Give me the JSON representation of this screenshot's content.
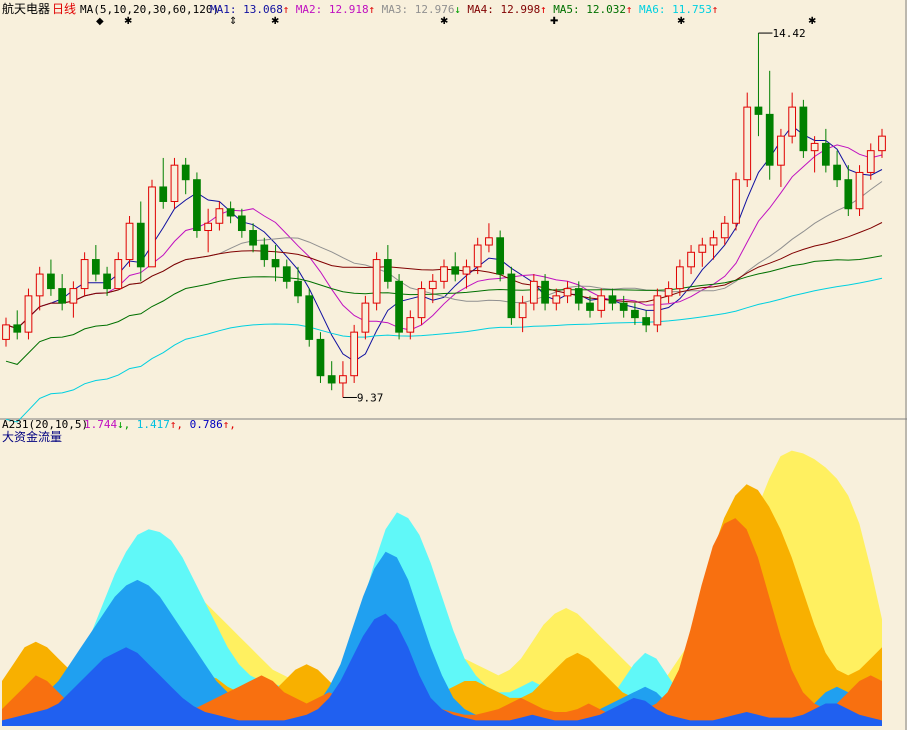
{
  "header": {
    "stock_name": "航天电器",
    "period": "日线",
    "ma_params": "MA(5,10,20,30,60,120)",
    "items": [
      {
        "label": "MA1:",
        "value": "13.068",
        "arrow": "↑",
        "color": "#1010A0"
      },
      {
        "label": "MA2:",
        "value": "12.918",
        "arrow": "↑",
        "color": "#C010C0"
      },
      {
        "label": "MA3:",
        "value": "12.976",
        "arrow": "↓",
        "color": "#909090"
      },
      {
        "label": "MA4:",
        "value": "12.998",
        "arrow": "↑",
        "color": "#800000"
      },
      {
        "label": "MA5:",
        "value": "12.032",
        "arrow": "↑",
        "color": "#007000"
      },
      {
        "label": "MA6:",
        "value": "11.753",
        "arrow": "↑",
        "color": "#00D0E0"
      }
    ],
    "arrow_up_color": "#E00000",
    "arrow_down_color": "#00A000"
  },
  "sub_header": {
    "indicator": "A231(20,10,5)",
    "values": [
      {
        "value": "1.744",
        "arrow": "↓",
        "color": "#C010C0"
      },
      {
        "value": "1.417",
        "arrow": "↑",
        "color": "#00C0E0"
      },
      {
        "value": "0.786",
        "arrow": "↑",
        "color": "#0000C0"
      }
    ],
    "title": "大资金流量"
  },
  "markers": {
    "high_label": "14.42",
    "low_label": "9.37"
  },
  "chart_data": [
    {
      "type": "candlestick",
      "title": "航天电器 日线",
      "ylim": [
        9.2,
        14.6
      ],
      "up_color": "#E00000",
      "down_color": "#008000",
      "candles": [
        [
          10.2,
          10.5,
          10.1,
          10.4
        ],
        [
          10.4,
          10.6,
          10.2,
          10.3
        ],
        [
          10.3,
          10.9,
          10.2,
          10.8
        ],
        [
          10.8,
          11.2,
          10.6,
          11.1
        ],
        [
          11.1,
          11.3,
          10.8,
          10.9
        ],
        [
          10.9,
          11.1,
          10.6,
          10.7
        ],
        [
          10.7,
          11.0,
          10.5,
          10.9
        ],
        [
          10.9,
          11.4,
          10.8,
          11.3
        ],
        [
          11.3,
          11.5,
          11.0,
          11.1
        ],
        [
          11.1,
          11.2,
          10.8,
          10.9
        ],
        [
          10.9,
          11.4,
          10.9,
          11.3
        ],
        [
          11.3,
          11.9,
          11.2,
          11.8
        ],
        [
          11.8,
          12.1,
          11.0,
          11.2
        ],
        [
          11.2,
          12.4,
          11.2,
          12.3
        ],
        [
          12.3,
          12.7,
          12.0,
          12.1
        ],
        [
          12.1,
          12.7,
          12.0,
          12.6
        ],
        [
          12.6,
          12.7,
          12.2,
          12.4
        ],
        [
          12.4,
          12.5,
          11.6,
          11.7
        ],
        [
          11.7,
          12.0,
          11.4,
          11.8
        ],
        [
          11.8,
          12.1,
          11.7,
          12.0
        ],
        [
          12.0,
          12.1,
          11.8,
          11.9
        ],
        [
          11.9,
          12.0,
          11.6,
          11.7
        ],
        [
          11.7,
          11.8,
          11.4,
          11.5
        ],
        [
          11.5,
          11.6,
          11.2,
          11.3
        ],
        [
          11.3,
          11.5,
          11.0,
          11.2
        ],
        [
          11.2,
          11.3,
          10.9,
          11.0
        ],
        [
          11.0,
          11.2,
          10.7,
          10.8
        ],
        [
          10.8,
          10.9,
          10.1,
          10.2
        ],
        [
          10.2,
          10.3,
          9.6,
          9.7
        ],
        [
          9.7,
          9.9,
          9.5,
          9.6
        ],
        [
          9.6,
          9.9,
          9.4,
          9.7
        ],
        [
          9.7,
          10.4,
          9.6,
          10.3
        ],
        [
          10.3,
          10.8,
          10.2,
          10.7
        ],
        [
          10.7,
          11.4,
          10.6,
          11.3
        ],
        [
          11.3,
          11.5,
          10.9,
          11.0
        ],
        [
          11.0,
          11.1,
          10.2,
          10.3
        ],
        [
          10.3,
          10.6,
          10.2,
          10.5
        ],
        [
          10.5,
          11.0,
          10.4,
          10.9
        ],
        [
          10.9,
          11.1,
          10.7,
          11.0
        ],
        [
          11.0,
          11.3,
          10.9,
          11.2
        ],
        [
          11.2,
          11.4,
          11.0,
          11.1
        ],
        [
          11.1,
          11.3,
          10.9,
          11.2
        ],
        [
          11.2,
          11.6,
          11.1,
          11.5
        ],
        [
          11.5,
          11.8,
          11.4,
          11.6
        ],
        [
          11.6,
          11.7,
          11.0,
          11.1
        ],
        [
          11.1,
          11.2,
          10.4,
          10.5
        ],
        [
          10.5,
          10.8,
          10.3,
          10.7
        ],
        [
          10.7,
          11.1,
          10.6,
          11.0
        ],
        [
          11.0,
          11.1,
          10.6,
          10.7
        ],
        [
          10.7,
          10.9,
          10.6,
          10.8
        ],
        [
          10.8,
          11.0,
          10.7,
          10.9
        ],
        [
          10.9,
          11.0,
          10.6,
          10.7
        ],
        [
          10.7,
          10.8,
          10.5,
          10.6
        ],
        [
          10.6,
          10.9,
          10.5,
          10.8
        ],
        [
          10.8,
          10.9,
          10.6,
          10.7
        ],
        [
          10.7,
          10.8,
          10.5,
          10.6
        ],
        [
          10.6,
          10.7,
          10.4,
          10.5
        ],
        [
          10.5,
          10.6,
          10.3,
          10.4
        ],
        [
          10.4,
          10.9,
          10.3,
          10.8
        ],
        [
          10.8,
          11.0,
          10.7,
          10.9
        ],
        [
          10.9,
          11.3,
          10.8,
          11.2
        ],
        [
          11.2,
          11.5,
          11.1,
          11.4
        ],
        [
          11.4,
          11.6,
          11.2,
          11.5
        ],
        [
          11.5,
          11.7,
          11.3,
          11.6
        ],
        [
          11.6,
          11.9,
          11.5,
          11.8
        ],
        [
          11.8,
          12.5,
          11.7,
          12.4
        ],
        [
          12.4,
          13.6,
          12.3,
          13.4
        ],
        [
          13.4,
          14.42,
          13.0,
          13.3
        ],
        [
          13.3,
          13.9,
          12.4,
          12.6
        ],
        [
          12.6,
          13.1,
          12.3,
          13.0
        ],
        [
          13.0,
          13.6,
          12.9,
          13.4
        ],
        [
          13.4,
          13.5,
          12.7,
          12.8
        ],
        [
          12.8,
          13.0,
          12.5,
          12.9
        ],
        [
          12.9,
          13.1,
          12.5,
          12.6
        ],
        [
          12.6,
          12.8,
          12.3,
          12.4
        ],
        [
          12.4,
          12.6,
          11.9,
          12.0
        ],
        [
          12.0,
          12.6,
          11.9,
          12.5
        ],
        [
          12.5,
          12.9,
          12.4,
          12.8
        ],
        [
          12.8,
          13.1,
          12.7,
          13.0
        ]
      ]
    },
    {
      "type": "area",
      "title": "大资金流量",
      "ylim": [
        0,
        1
      ],
      "series": [
        {
          "color": "#FFF060",
          "values": [
            0.1,
            0.14,
            0.16,
            0.18,
            0.2,
            0.19,
            0.18,
            0.17,
            0.2,
            0.24,
            0.3,
            0.38,
            0.46,
            0.52,
            0.55,
            0.54,
            0.52,
            0.48,
            0.44,
            0.4,
            0.36,
            0.32,
            0.28,
            0.24,
            0.2,
            0.18,
            0.16,
            0.15,
            0.14,
            0.14,
            0.15,
            0.18,
            0.22,
            0.28,
            0.34,
            0.4,
            0.42,
            0.4,
            0.36,
            0.32,
            0.28,
            0.24,
            0.22,
            0.2,
            0.18,
            0.2,
            0.24,
            0.3,
            0.36,
            0.4,
            0.42,
            0.4,
            0.36,
            0.32,
            0.28,
            0.24,
            0.2,
            0.16,
            0.14,
            0.18,
            0.24,
            0.3,
            0.36,
            0.42,
            0.48,
            0.56,
            0.66,
            0.78,
            0.88,
            0.96,
            0.98,
            0.97,
            0.95,
            0.92,
            0.88,
            0.82,
            0.72,
            0.56,
            0.38
          ]
        },
        {
          "color": "#60F8F8",
          "values": [
            0.05,
            0.08,
            0.1,
            0.12,
            0.14,
            0.16,
            0.2,
            0.26,
            0.34,
            0.44,
            0.54,
            0.62,
            0.68,
            0.7,
            0.69,
            0.66,
            0.6,
            0.52,
            0.44,
            0.36,
            0.28,
            0.22,
            0.18,
            0.16,
            0.15,
            0.14,
            0.13,
            0.12,
            0.12,
            0.14,
            0.2,
            0.3,
            0.44,
            0.58,
            0.7,
            0.76,
            0.74,
            0.68,
            0.58,
            0.46,
            0.34,
            0.24,
            0.18,
            0.14,
            0.12,
            0.12,
            0.14,
            0.16,
            0.14,
            0.1,
            0.06,
            0.04,
            0.04,
            0.06,
            0.1,
            0.16,
            0.22,
            0.26,
            0.24,
            0.18,
            0.12,
            0.08,
            0.06,
            0.06,
            0.08,
            0.1,
            0.1,
            0.08,
            0.06,
            0.05,
            0.05,
            0.06,
            0.08,
            0.1,
            0.12,
            0.14,
            0.12,
            0.08,
            0.04
          ]
        },
        {
          "color": "#F8B000",
          "values": [
            0.16,
            0.22,
            0.28,
            0.3,
            0.28,
            0.24,
            0.2,
            0.16,
            0.12,
            0.1,
            0.08,
            0.06,
            0.05,
            0.05,
            0.06,
            0.08,
            0.12,
            0.16,
            0.18,
            0.17,
            0.14,
            0.12,
            0.1,
            0.1,
            0.12,
            0.16,
            0.2,
            0.22,
            0.2,
            0.16,
            0.12,
            0.08,
            0.06,
            0.04,
            0.04,
            0.05,
            0.06,
            0.08,
            0.1,
            0.12,
            0.14,
            0.16,
            0.16,
            0.14,
            0.12,
            0.1,
            0.1,
            0.12,
            0.16,
            0.2,
            0.24,
            0.26,
            0.24,
            0.2,
            0.16,
            0.12,
            0.1,
            0.08,
            0.08,
            0.12,
            0.2,
            0.32,
            0.48,
            0.62,
            0.74,
            0.82,
            0.86,
            0.84,
            0.78,
            0.7,
            0.6,
            0.48,
            0.36,
            0.26,
            0.2,
            0.18,
            0.2,
            0.24,
            0.28
          ]
        },
        {
          "color": "#20A0F0",
          "values": [
            0.04,
            0.06,
            0.08,
            0.1,
            0.12,
            0.16,
            0.22,
            0.28,
            0.34,
            0.4,
            0.46,
            0.5,
            0.52,
            0.5,
            0.46,
            0.4,
            0.34,
            0.28,
            0.22,
            0.16,
            0.12,
            0.08,
            0.06,
            0.05,
            0.04,
            0.04,
            0.05,
            0.06,
            0.08,
            0.14,
            0.22,
            0.34,
            0.46,
            0.56,
            0.62,
            0.6,
            0.52,
            0.4,
            0.28,
            0.18,
            0.1,
            0.06,
            0.04,
            0.03,
            0.03,
            0.04,
            0.05,
            0.06,
            0.05,
            0.04,
            0.03,
            0.03,
            0.04,
            0.06,
            0.08,
            0.1,
            0.12,
            0.14,
            0.12,
            0.08,
            0.05,
            0.04,
            0.03,
            0.03,
            0.04,
            0.05,
            0.06,
            0.06,
            0.05,
            0.04,
            0.04,
            0.05,
            0.08,
            0.12,
            0.14,
            0.12,
            0.08,
            0.05,
            0.03
          ]
        },
        {
          "color": "#F87010",
          "values": [
            0.06,
            0.1,
            0.14,
            0.18,
            0.16,
            0.12,
            0.08,
            0.06,
            0.04,
            0.04,
            0.05,
            0.06,
            0.06,
            0.05,
            0.04,
            0.04,
            0.05,
            0.06,
            0.08,
            0.1,
            0.12,
            0.14,
            0.16,
            0.18,
            0.16,
            0.12,
            0.1,
            0.08,
            0.1,
            0.12,
            0.1,
            0.08,
            0.06,
            0.05,
            0.04,
            0.04,
            0.05,
            0.06,
            0.08,
            0.06,
            0.05,
            0.04,
            0.04,
            0.05,
            0.06,
            0.08,
            0.1,
            0.08,
            0.06,
            0.05,
            0.05,
            0.06,
            0.08,
            0.06,
            0.04,
            0.04,
            0.05,
            0.06,
            0.08,
            0.12,
            0.2,
            0.34,
            0.5,
            0.64,
            0.72,
            0.74,
            0.7,
            0.6,
            0.46,
            0.32,
            0.2,
            0.12,
            0.08,
            0.06,
            0.08,
            0.12,
            0.16,
            0.18,
            0.16
          ]
        },
        {
          "color": "#2060F0",
          "values": [
            0.02,
            0.03,
            0.04,
            0.05,
            0.06,
            0.08,
            0.12,
            0.16,
            0.2,
            0.24,
            0.26,
            0.28,
            0.26,
            0.22,
            0.18,
            0.14,
            0.1,
            0.07,
            0.05,
            0.04,
            0.03,
            0.02,
            0.02,
            0.02,
            0.02,
            0.02,
            0.03,
            0.04,
            0.06,
            0.1,
            0.16,
            0.24,
            0.32,
            0.38,
            0.4,
            0.36,
            0.28,
            0.18,
            0.1,
            0.06,
            0.04,
            0.03,
            0.02,
            0.02,
            0.02,
            0.02,
            0.03,
            0.04,
            0.03,
            0.02,
            0.02,
            0.02,
            0.03,
            0.04,
            0.06,
            0.08,
            0.1,
            0.09,
            0.06,
            0.04,
            0.03,
            0.02,
            0.02,
            0.02,
            0.03,
            0.04,
            0.05,
            0.04,
            0.03,
            0.03,
            0.03,
            0.04,
            0.06,
            0.08,
            0.08,
            0.06,
            0.04,
            0.03,
            0.02
          ]
        }
      ]
    }
  ]
}
